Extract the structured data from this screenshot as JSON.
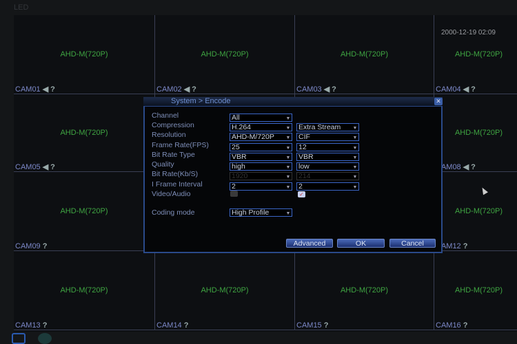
{
  "bezel": {
    "label": "LED"
  },
  "clock": "2000-12-19 02:09",
  "signal_label": "AHD-M(720P)",
  "cameras": [
    {
      "name": "CAM01",
      "icons": "audio"
    },
    {
      "name": "CAM02",
      "icons": "audio"
    },
    {
      "name": "CAM03",
      "icons": "audio"
    },
    {
      "name": "CAM04",
      "icons": "audio"
    },
    {
      "name": "CAM05",
      "icons": "audio"
    },
    {
      "name": "CAM06",
      "icons": "audio"
    },
    {
      "name": "CAM07",
      "icons": "audio"
    },
    {
      "name": "CAM08",
      "icons": "audio"
    },
    {
      "name": "CAM09"
    },
    {
      "name": "CAM10"
    },
    {
      "name": "CAM11"
    },
    {
      "name": "CAM12"
    },
    {
      "name": "CAM13"
    },
    {
      "name": "CAM14"
    },
    {
      "name": "CAM15"
    },
    {
      "name": "CAM16"
    }
  ],
  "dialog": {
    "title": "System > Encode",
    "rows": [
      {
        "label": "Channel",
        "main": "All"
      },
      {
        "label": "Compression",
        "main": "H.264",
        "extra": "Extra Stream"
      },
      {
        "label": "Resolution",
        "main": "AHD-M/720P",
        "extra": "CIF"
      },
      {
        "label": "Frame Rate(FPS)",
        "main": "25",
        "extra": "12"
      },
      {
        "label": "Bit Rate Type",
        "main": "VBR",
        "extra": "VBR"
      },
      {
        "label": "Quality",
        "main": "high",
        "extra": "low"
      },
      {
        "label": "Bit Rate(Kb/S)",
        "main": "1920",
        "extra": "214",
        "disabled": true
      },
      {
        "label": "I Frame Interval",
        "main": " 2",
        "extra": " 2"
      }
    ],
    "video_audio": {
      "label": "Video/Audio",
      "main_checked": false,
      "extra_checked": true
    },
    "coding_mode": {
      "label": "Coding mode",
      "value": "High Profile"
    },
    "buttons": {
      "advanced": "Advanced",
      "ok": "OK",
      "cancel": "Cancel"
    }
  },
  "colors": {
    "signal": "#3fa542",
    "cam_label": "#7c88c8",
    "accent": "#3b66c8"
  }
}
